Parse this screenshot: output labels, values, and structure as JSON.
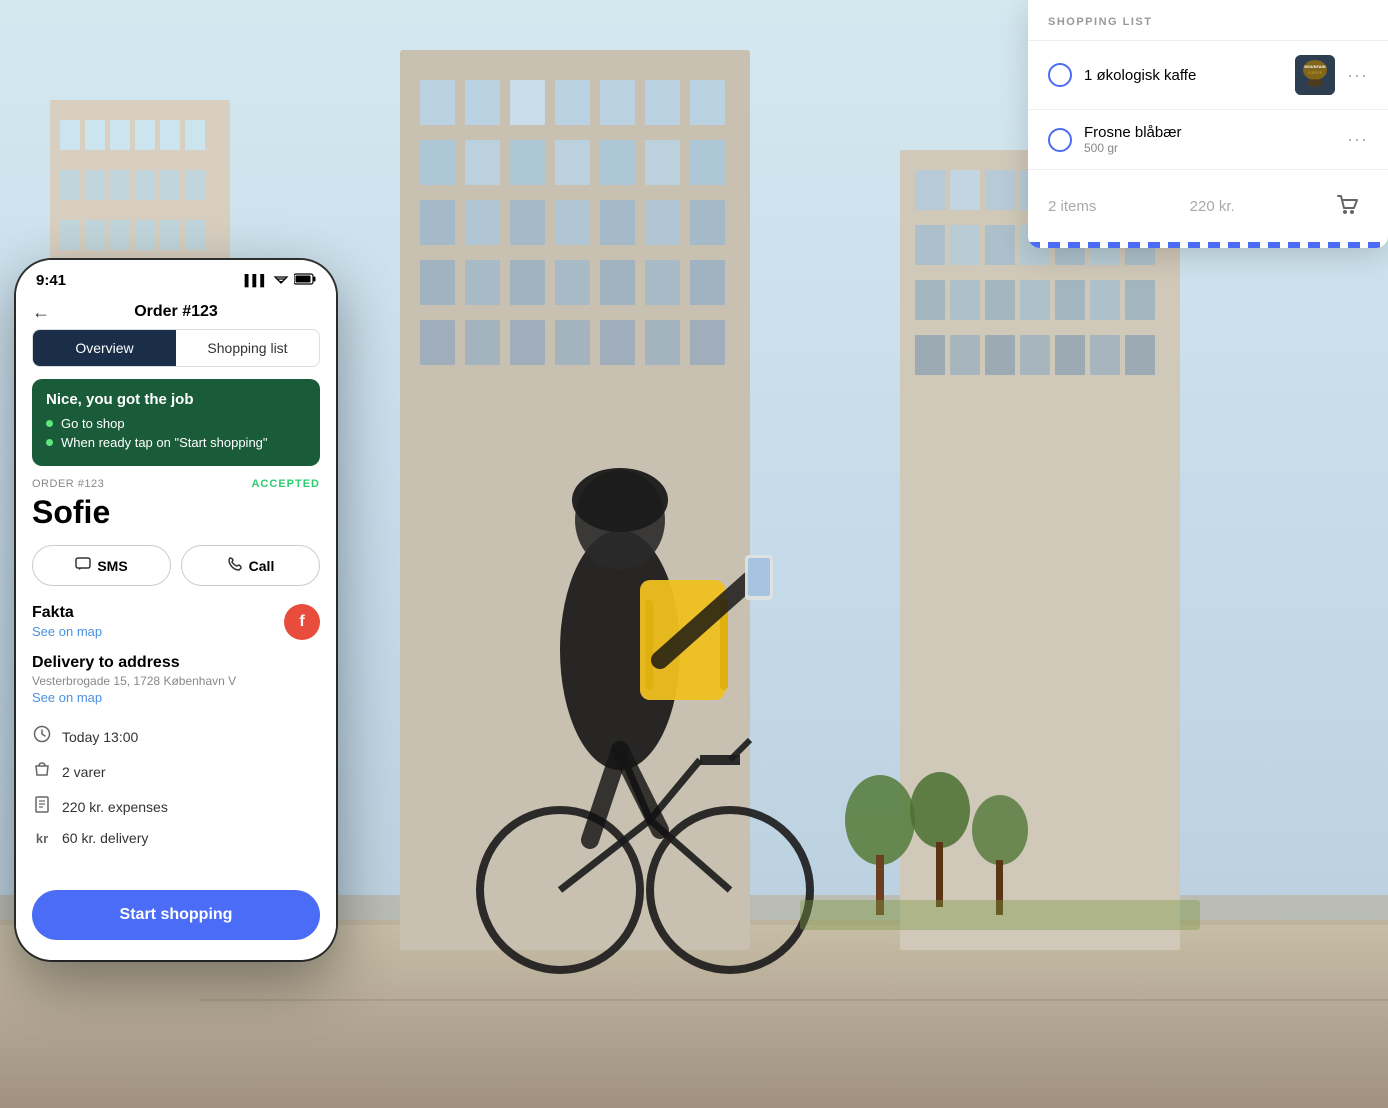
{
  "background": {
    "description": "Urban scene with buildings and courier on bicycle"
  },
  "phone": {
    "status_bar": {
      "time": "9:41",
      "signal": "▌▌▌",
      "wifi": "WiFi",
      "battery": "Battery"
    },
    "nav": {
      "title": "Order #123",
      "back_label": "←"
    },
    "tabs": [
      {
        "label": "Overview",
        "active": true
      },
      {
        "label": "Shopping list",
        "active": false
      }
    ],
    "info_box": {
      "title": "Nice, you got the job",
      "items": [
        "Go to shop",
        "When ready tap on \"Start shopping\""
      ]
    },
    "order": {
      "label": "ORDER #123",
      "status": "ACCEPTED",
      "customer_name": "Sofie"
    },
    "action_buttons": [
      {
        "label": "SMS",
        "icon": "💬"
      },
      {
        "label": "Call",
        "icon": "📞"
      }
    ],
    "store": {
      "name": "Fakta",
      "map_link": "See on map",
      "icon_letter": "f"
    },
    "delivery": {
      "title": "Delivery to address",
      "address": "Vesterbrogade 15, 1728 København V",
      "map_link": "See on map"
    },
    "details": [
      {
        "icon": "🕐",
        "text": "Today 13:00"
      },
      {
        "icon": "🛍",
        "text": "2 varer"
      },
      {
        "icon": "🧾",
        "text": "220 kr. expenses"
      },
      {
        "icon": "kr",
        "text": "60 kr. delivery"
      }
    ],
    "start_shopping_label": "Start shopping"
  },
  "shopping_list_card": {
    "header": "SHOPPING LIST",
    "items": [
      {
        "name": "1 økologisk kaffe",
        "detail": "",
        "has_image": true,
        "image_label": "MOUNTAIN"
      },
      {
        "name": "Frosne blåbær",
        "detail": "500 gr",
        "has_image": false
      }
    ],
    "footer": {
      "count_label": "2 items",
      "price_label": "220 kr.",
      "cart_icon": "🛒"
    }
  }
}
